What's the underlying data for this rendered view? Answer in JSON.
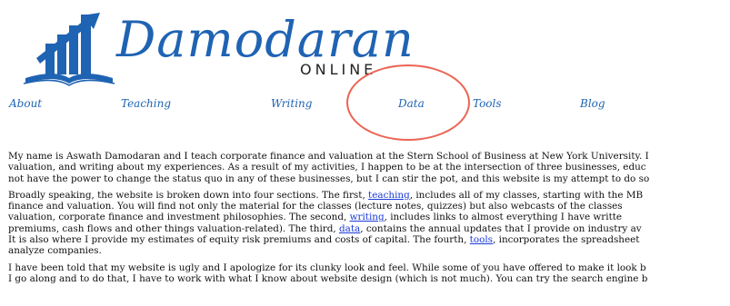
{
  "logo": {
    "name": "Damodaran",
    "sub": "ONLINE"
  },
  "nav": {
    "items": [
      {
        "key": "about",
        "label": "About"
      },
      {
        "key": "teaching",
        "label": "Teaching"
      },
      {
        "key": "writing",
        "label": "Writing"
      },
      {
        "key": "data",
        "label": "Data"
      },
      {
        "key": "tools",
        "label": "Tools"
      },
      {
        "key": "blog",
        "label": "Blog"
      }
    ]
  },
  "content": {
    "p1": [
      "My name is Aswath Damodaran and I teach corporate finance and valuation at the Stern School of Business at New York University. I",
      "valuation, and writing about my experiences. As a result of my activities, I happen to be at the intersection of three businesses, educ",
      "not have the power to change the status quo in any of these businesses, but I can stir the pot, and this website is my attempt to do so"
    ],
    "p2": {
      "l1_a": "Broadly speaking, the website is broken down into four sections. The first, ",
      "link_teaching": "teaching",
      "l1_b": ", includes all of my classes, starting with the MB",
      "l2": "finance and valuation. You will find not only the material for the classes (lecture notes, quizzes) but also webcasts of the classes",
      "l3_a": "valuation, corporate finance and investment philosophies. The second, ",
      "link_writing": "writing",
      "l3_b": ", includes links to almost everything I have writte",
      "l4_a": "premiums, cash flows and other things valuation-related). The third, ",
      "link_data": "data",
      "l4_b": ", contains the annual updates that I provide on industry av",
      "l5_a": "It is also where I provide my estimates of equity risk premiums and costs of capital. The fourth, ",
      "link_tools": "tools",
      "l5_b": ", incorporates the spreadsheet",
      "l6": "analyze companies."
    },
    "p3": [
      "I have been told that my website is ugly and I apologize for its clunky look and feel. While some of you have offered to make it look b",
      "I go along and to do that, I have to work with what I know about website design (which is not much). You can try the search engine b"
    ]
  },
  "colors": {
    "brand_blue": "#1f63b3",
    "circle_red": "#ec6454",
    "link_blue": "#1a3ad8"
  }
}
